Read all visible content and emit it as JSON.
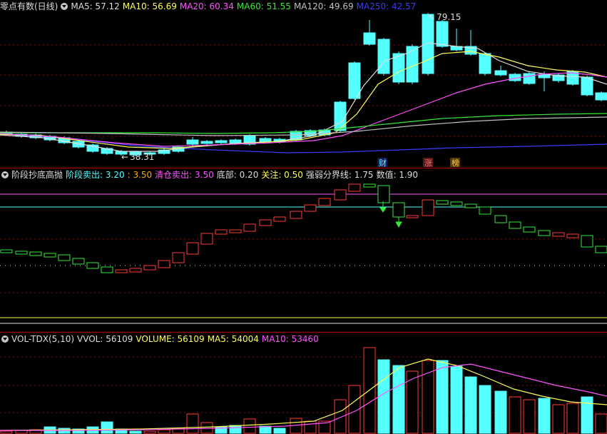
{
  "colors": {
    "up": "#ff3a3a",
    "down": "#54ffff",
    "white": "#dcdcdc",
    "yellow": "#ffff54",
    "magenta": "#ff54ff",
    "green": "#38e838",
    "blue": "#3b3bff",
    "grid": "#8b0000"
  },
  "main_panel": {
    "title": "零点有数(日线)",
    "indicators": [
      {
        "label": "MA5: 57.12",
        "color": "#dcdcdc"
      },
      {
        "label": "MA10: 56.69",
        "color": "#ffff54"
      },
      {
        "label": "MA20: 60.34",
        "color": "#ff54ff"
      },
      {
        "label": "MA60: 51.55",
        "color": "#38e838"
      },
      {
        "label": "MA120: 49.69",
        "color": "#c0c0c0"
      },
      {
        "label": "MA250: 42.57",
        "color": "#3b3bff"
      }
    ],
    "high_label": "79.15",
    "low_label": "38.31",
    "markers": [
      "财",
      "涨",
      "榜"
    ],
    "menu_icon": "chevron-down-circle-icon"
  },
  "mid_panel": {
    "title": "阶段抄底高抛",
    "indicators": [
      {
        "label": "阶段卖出: 3.20",
        "color": "#54ffff"
      },
      {
        "label": ": 3.50",
        "color": "#ffaa00"
      },
      {
        "label": "清仓卖出: 3.50",
        "color": "#ff54ff"
      },
      {
        "label": "底部: 0.20",
        "color": "#dcdcdc"
      },
      {
        "label": "关注: 0.50",
        "color": "#ffff54"
      },
      {
        "label": "强弱分界线: 1.75",
        "color": "#dcdcdc"
      },
      {
        "label": "数值: 1.90",
        "color": "#dcdcdc"
      }
    ]
  },
  "vol_panel": {
    "title": "VOL-TDX(5,10)",
    "indicators": [
      {
        "label": "VVOL: 56109",
        "color": "#dcdcdc"
      },
      {
        "label": "VOLUME: 56109",
        "color": "#ffff54"
      },
      {
        "label": "MA5: 54004",
        "color": "#ffff54"
      },
      {
        "label": "MA10: 53460",
        "color": "#ff54ff"
      }
    ]
  }
}
